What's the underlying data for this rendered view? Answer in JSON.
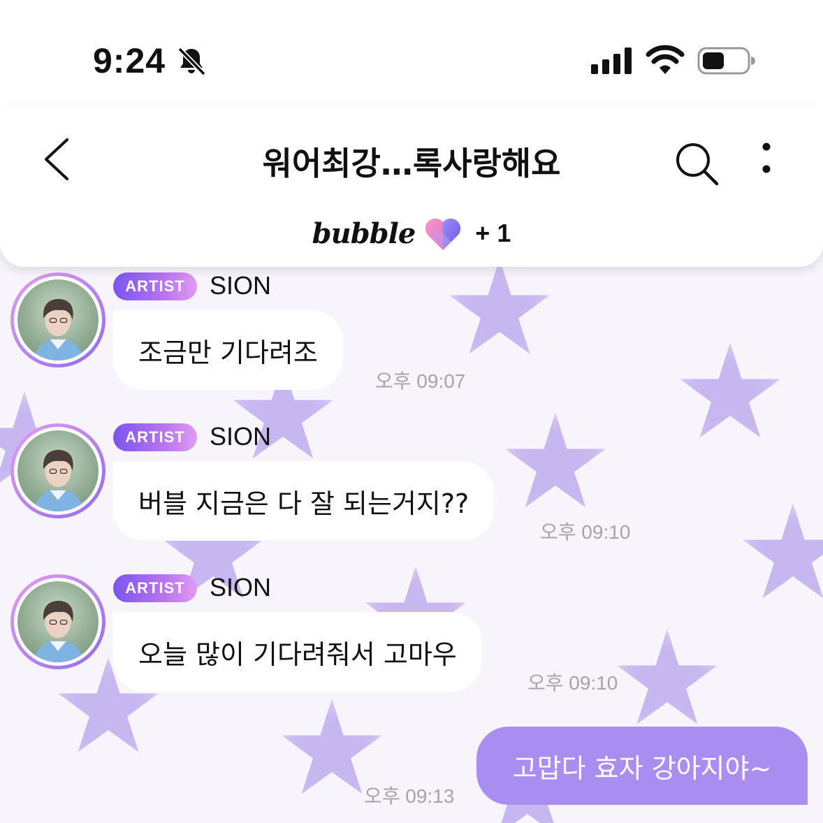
{
  "status_bar": {
    "time": "9:24",
    "icons": [
      "bell-off-icon",
      "signal-icon",
      "wifi-icon",
      "battery-icon"
    ]
  },
  "header": {
    "title": "워어최강…록사랑해요",
    "brand": "bubble",
    "plus_count": "+ 1",
    "icons": [
      "back-icon",
      "search-icon",
      "more-icon",
      "heart-icon"
    ]
  },
  "messages": [
    {
      "badge": "ARTIST",
      "sender": "SION",
      "text": "조금만 기다려조",
      "time": "오후 09:07"
    },
    {
      "badge": "ARTIST",
      "sender": "SION",
      "text": "버블 지금은 다 잘 되는거지??",
      "time": "오후 09:10"
    },
    {
      "badge": "ARTIST",
      "sender": "SION",
      "text": "오늘 많이 기다려줘서 고마우",
      "time": "오후 09:10"
    }
  ],
  "my_message": {
    "text": "고맙다 효자 강아지야~",
    "time": "오후 09:13"
  },
  "colors": {
    "accent": "#a98df0",
    "badge_start": "#7a55f0",
    "badge_end": "#e09af2",
    "background": "#f7f4fb",
    "star": "#b7a3ec"
  }
}
